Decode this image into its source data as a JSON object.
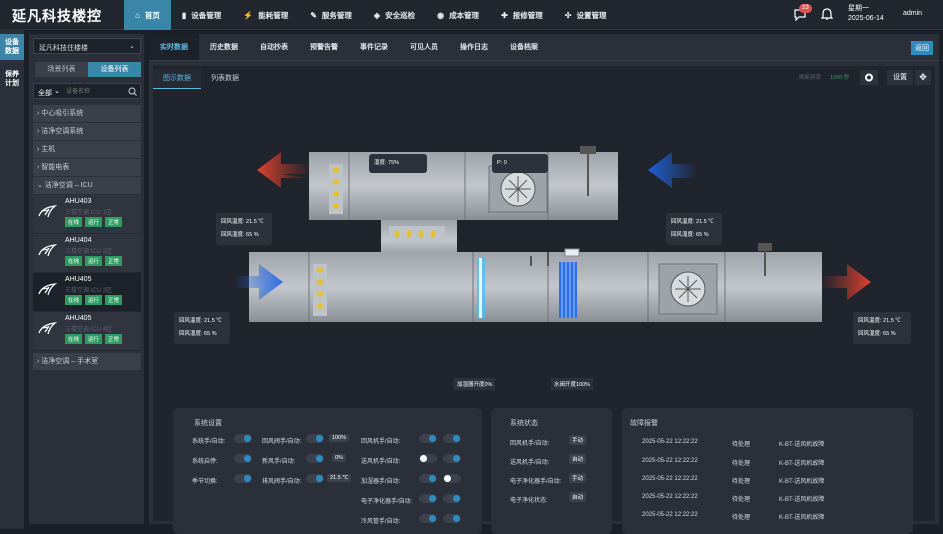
{
  "app": {
    "title": "延凡科技楼控",
    "weekday": "星期一",
    "date": "2025-06-14",
    "user": "admin",
    "notify_count": "23"
  },
  "nav": [
    {
      "label": "首页",
      "icon": "home-icon"
    },
    {
      "label": "设备管理",
      "icon": "device-icon"
    },
    {
      "label": "能耗管理",
      "icon": "energy-icon"
    },
    {
      "label": "服务管理",
      "icon": "service-icon"
    },
    {
      "label": "安全巡检",
      "icon": "shield-icon"
    },
    {
      "label": "成本管理",
      "icon": "cost-icon"
    },
    {
      "label": "报修管理",
      "icon": "wrench-icon"
    },
    {
      "label": "设置管理",
      "icon": "puzzle-icon"
    }
  ],
  "leftbar": [
    {
      "label": "设备\n数据"
    },
    {
      "label": "保养\n计划"
    }
  ],
  "side": {
    "building": "延凡科技住楼楼",
    "tabs": [
      "场景列表",
      "设备列表"
    ],
    "filter": "全部",
    "search_placeholder": "设备名称",
    "tree": [
      "中心吸引系统",
      "洁净空调系统",
      "主机",
      "智能电表",
      "洁净空调 – ICU"
    ],
    "devices": [
      {
        "name": "AHU403",
        "sub": "三楼空调 ICU 1区",
        "tags": [
          "在线",
          "运行",
          "正常"
        ]
      },
      {
        "name": "AHU404",
        "sub": "三楼空调 ICU 2区",
        "tags": [
          "在线",
          "运行",
          "正常"
        ]
      },
      {
        "name": "AHU405",
        "sub": "三楼空调 ICU 3区",
        "tags": [
          "在线",
          "运行",
          "正常"
        ]
      },
      {
        "name": "AHU405",
        "sub": "三楼空调 ICU 4区",
        "tags": [
          "在线",
          "运行",
          "正常"
        ]
      }
    ],
    "tree_last": "洁净空调 – 手术室"
  },
  "main": {
    "tabs": [
      "实时数据",
      "历史数据",
      "自动抄表",
      "预警告警",
      "事件记录",
      "可见人员",
      "操作日志",
      "设备档案"
    ],
    "back": "返回",
    "subtabs": [
      "图示数据",
      "列表数据"
    ],
    "refresh_label": "刷新频率",
    "refresh_value": "1000 秒",
    "settings": "设置"
  },
  "diagram": {
    "humidity": "湿度: 75%",
    "pressure": "P: 0",
    "left_top": [
      "回风温度: 21.5 ℃",
      "回风湿度: 65 %"
    ],
    "right_top": [
      "回风温度: 21.5 ℃",
      "回风湿度: 65 %"
    ],
    "left_bottom": [
      "回风温度: 21.5 ℃",
      "回风湿度: 65 %"
    ],
    "right_bottom": [
      "回风温度: 21.5 ℃",
      "回风湿度: 65 %"
    ],
    "humidifier": "加湿器开度0%",
    "valve": "水阀开度100%"
  },
  "sys_settings": {
    "title": "系统设置",
    "col1": [
      "系统手/自动:",
      "系统启停:",
      "季节切换:"
    ],
    "col2": [
      "回风阀手/自动:",
      "新风手/自动:",
      "排风阀手/自动:"
    ],
    "col2_vals": [
      "100%",
      "0%",
      "21.5 ℃"
    ],
    "col3": [
      "回风机手/自动:",
      "送风机手/自动:",
      "加湿器手/自动:",
      "电子净化器手/自动:",
      "冷风管手/自动:"
    ]
  },
  "sys_status": {
    "title": "系统状态",
    "rows": [
      {
        "label": "回风机手/自动:",
        "val": "手动"
      },
      {
        "label": "送风机手/自动:",
        "val": "自动"
      },
      {
        "label": "电子净化器手/自动:",
        "val": "手动"
      },
      {
        "label": "电子净化状态:",
        "val": "自动"
      }
    ]
  },
  "faults": {
    "title": "故障报警",
    "rows": [
      {
        "time": "2025-05-22 12:22:22",
        "state": "待处理",
        "msg": "K-BT-送风机故障"
      },
      {
        "time": "2025-05-22 12:22:22",
        "state": "待处理",
        "msg": "K-BT-送风机故障"
      },
      {
        "time": "2025-05-22 12:22:22",
        "state": "待处理",
        "msg": "K-BT-送风机故障"
      },
      {
        "time": "2025-05-22 12:22:22",
        "state": "待处理",
        "msg": "K-BT-送风机故障"
      },
      {
        "time": "2025-05-22 12:22:22",
        "state": "待处理",
        "msg": "K-BT-送风机故障"
      }
    ]
  }
}
